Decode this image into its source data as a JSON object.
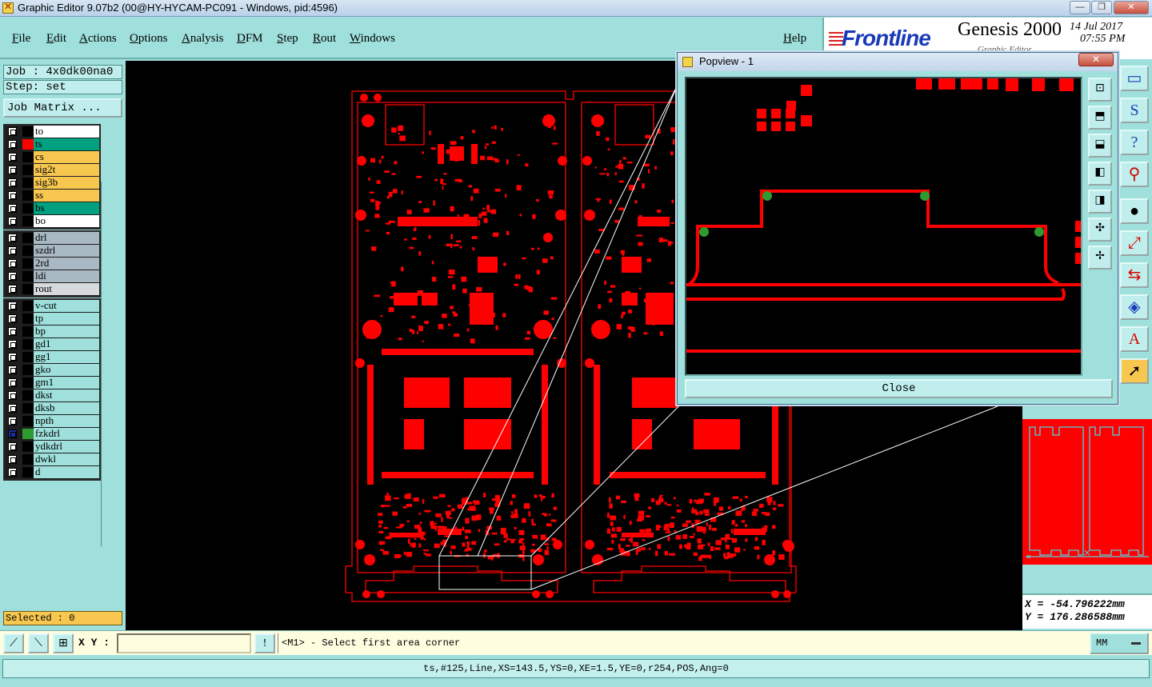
{
  "window": {
    "title": "Graphic Editor 9.07b2 (00@HY-HYCAM-PC091 - Windows, pid:4596)",
    "minimize": "—",
    "maximize": "❐",
    "close": "✕"
  },
  "menu": [
    "File",
    "Edit",
    "Actions",
    "Options",
    "Analysis",
    "DFM",
    "Step",
    "Rout",
    "Windows"
  ],
  "help": "Help",
  "logo": {
    "brand": "Frontline",
    "product": "Genesis 2000",
    "subtitle": "Graphic Editor",
    "date": "14 Jul 2017",
    "time": "07:55 PM"
  },
  "job": "Job : 4x0dk00na0",
  "step": "Step: set",
  "job_matrix": "Job Matrix ...",
  "layers": {
    "board": [
      {
        "name": "to",
        "bg": "#ffffff",
        "sw": "#000000"
      },
      {
        "name": "ts",
        "bg": "#00a080",
        "sw": "#ff0000"
      },
      {
        "name": "cs",
        "bg": "#f7c750",
        "sw": "#000000"
      },
      {
        "name": "sig2t",
        "bg": "#f7c750",
        "sw": "#000000"
      },
      {
        "name": "sig3b",
        "bg": "#f7c750",
        "sw": "#000000"
      },
      {
        "name": "ss",
        "bg": "#f7c750",
        "sw": "#000000"
      },
      {
        "name": "bs",
        "bg": "#00a080",
        "sw": "#000000"
      },
      {
        "name": "bo",
        "bg": "#ffffff",
        "sw": "#000000"
      }
    ],
    "drill": [
      {
        "name": "drl",
        "bg": "#a8b9c4",
        "sw": "#000000"
      },
      {
        "name": "szdrl",
        "bg": "#a8b9c4",
        "sw": "#000000"
      },
      {
        "name": "2rd",
        "bg": "#a8b9c4",
        "sw": "#000000"
      },
      {
        "name": "ldi",
        "bg": "#a8b9c4",
        "sw": "#000000"
      },
      {
        "name": "rout",
        "bg": "#d6dadd",
        "sw": "#000000"
      }
    ],
    "misc": [
      {
        "name": "v-cut",
        "bg": "#9fe0dc",
        "sw": "#000000"
      },
      {
        "name": "tp",
        "bg": "#9fe0dc",
        "sw": "#000000"
      },
      {
        "name": "bp",
        "bg": "#9fe0dc",
        "sw": "#000000"
      },
      {
        "name": "gd1",
        "bg": "#9fe0dc",
        "sw": "#000000"
      },
      {
        "name": "gg1",
        "bg": "#9fe0dc",
        "sw": "#000000"
      },
      {
        "name": "gko",
        "bg": "#9fe0dc",
        "sw": "#000000"
      },
      {
        "name": "gm1",
        "bg": "#9fe0dc",
        "sw": "#000000"
      },
      {
        "name": "dkst",
        "bg": "#9fe0dc",
        "sw": "#000000"
      },
      {
        "name": "dksb",
        "bg": "#9fe0dc",
        "sw": "#000000"
      },
      {
        "name": "npth",
        "bg": "#9fe0dc",
        "sw": "#000000"
      },
      {
        "name": "fzkdrl",
        "bg": "#9fe0dc",
        "sw": "#2f9a2f",
        "active": true
      },
      {
        "name": "ydkdrl",
        "bg": "#9fe0dc",
        "sw": "#000000"
      },
      {
        "name": "dwkl",
        "bg": "#9fe0dc",
        "sw": "#000000"
      },
      {
        "name": "d",
        "bg": "#9fe0dc",
        "sw": "#000000"
      }
    ]
  },
  "selected": "Selected : 0",
  "popview": {
    "title": "Popview - 1",
    "close_x": "✕",
    "close_button": "Close"
  },
  "coords": {
    "x": "X = -54.796222mm",
    "y": "Y = 176.286588mm"
  },
  "command": {
    "xy_label": "X Y :",
    "xy_value": "",
    "excl": "!",
    "prompt": "<M1> - Select first area corner",
    "units": "MM"
  },
  "status": "ts,#125,Line,XS=143.5,YS=0,XE=1.5,YE=0,r254,POS,Ang=0",
  "colors": {
    "copper": "#ff0000",
    "background": "#000000",
    "panel": "#9fe0dc",
    "highlight": "#2f9a2f"
  }
}
